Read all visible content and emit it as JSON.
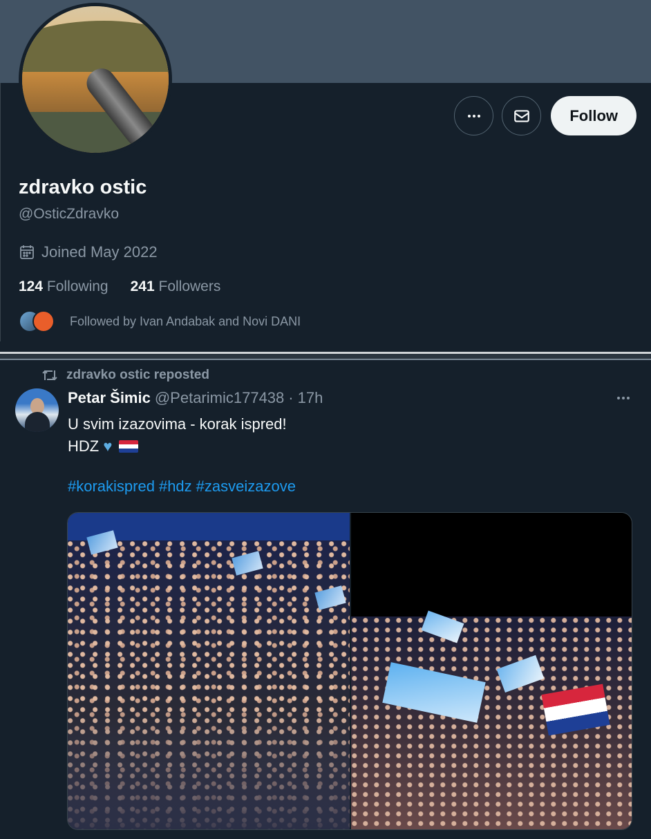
{
  "profile": {
    "display_name": "zdravko ostic",
    "handle": "@OsticZdravko",
    "joined": "Joined May 2022",
    "following_count": "124",
    "following_label": "Following",
    "followers_count": "241",
    "followers_label": "Followers",
    "followed_by": "Followed by Ivan Andabak and Novi DANI",
    "follow_button": "Follow",
    "more_icon": "more-horizontal-icon",
    "message_icon": "envelope-icon"
  },
  "post": {
    "repost_text": "zdravko ostic reposted",
    "author": "Petar Šimic",
    "author_handle": "@Petarimic177438",
    "separator": "·",
    "time": "17h",
    "line1": "U svim izazovima - korak ispred!",
    "line2": "HDZ",
    "hashtags": [
      "#korakispred",
      "#hdz",
      "#zasveizazove"
    ]
  },
  "colors": {
    "background": "#15202b",
    "banner": "#425364",
    "accent": "#1d9bf0",
    "muted": "#8b98a5"
  }
}
